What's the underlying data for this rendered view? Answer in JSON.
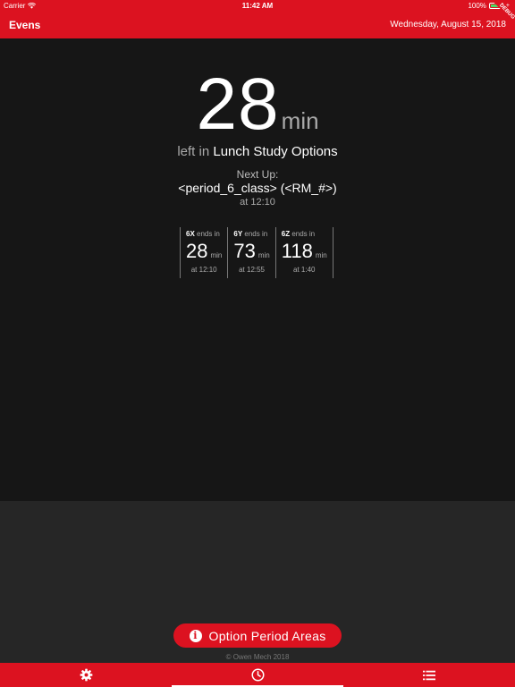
{
  "status_bar": {
    "carrier": "Carrier",
    "time": "11:42 AM",
    "battery": "100%",
    "debug": "DEBUG"
  },
  "header": {
    "title": "Evens",
    "date": "Wednesday, August 15, 2018"
  },
  "current": {
    "minutes": "28",
    "unit": "min",
    "left_in_prefix": "left in",
    "class_name": "Lunch Study Options"
  },
  "next_up": {
    "label": "Next Up:",
    "class_name": "<period_6_class> (<RM_#>)",
    "time": "at 12:10"
  },
  "sub_periods": [
    {
      "name": "6X",
      "ends_label": "ends in",
      "minutes": "28",
      "unit": "min",
      "time": "at 12:10"
    },
    {
      "name": "6Y",
      "ends_label": "ends in",
      "minutes": "73",
      "unit": "min",
      "time": "at 12:55"
    },
    {
      "name": "6Z",
      "ends_label": "ends in",
      "minutes": "118",
      "unit": "min",
      "time": "at 1:40"
    }
  ],
  "option_button": {
    "label": "Option Period Areas",
    "icon": "info-icon"
  },
  "footer": {
    "copyright": "© Owen Mech 2018"
  },
  "tabs": [
    {
      "icon": "gear-icon",
      "selected": false
    },
    {
      "icon": "clock-icon",
      "selected": true
    },
    {
      "icon": "list-icon",
      "selected": false
    }
  ]
}
